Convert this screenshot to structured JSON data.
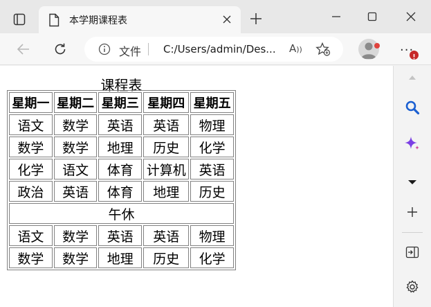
{
  "browser": {
    "tab_title": "本学期课程表",
    "site_label": "文件",
    "url": "C:/Users/admin/Des...",
    "read_aloud": "A"
  },
  "page": {
    "caption": "课程表",
    "headers": [
      "星期一",
      "星期二",
      "星期三",
      "星期四",
      "星期五"
    ],
    "morning_rows": [
      [
        "语文",
        "数学",
        "英语",
        "英语",
        "物理"
      ],
      [
        "数学",
        "数学",
        "地理",
        "历史",
        "化学"
      ],
      [
        "化学",
        "语文",
        "体育",
        "计算机",
        "英语"
      ],
      [
        "政治",
        "英语",
        "体育",
        "地理",
        "历史"
      ]
    ],
    "break_label": "午休",
    "afternoon_rows": [
      [
        "语文",
        "数学",
        "英语",
        "英语",
        "物理"
      ],
      [
        "数学",
        "数学",
        "地理",
        "历史",
        "化学"
      ]
    ]
  },
  "colors": {
    "search_accent": "#1a5fd1",
    "copilot_accent": "#7b3fe4",
    "notification_red": "#c62828"
  }
}
